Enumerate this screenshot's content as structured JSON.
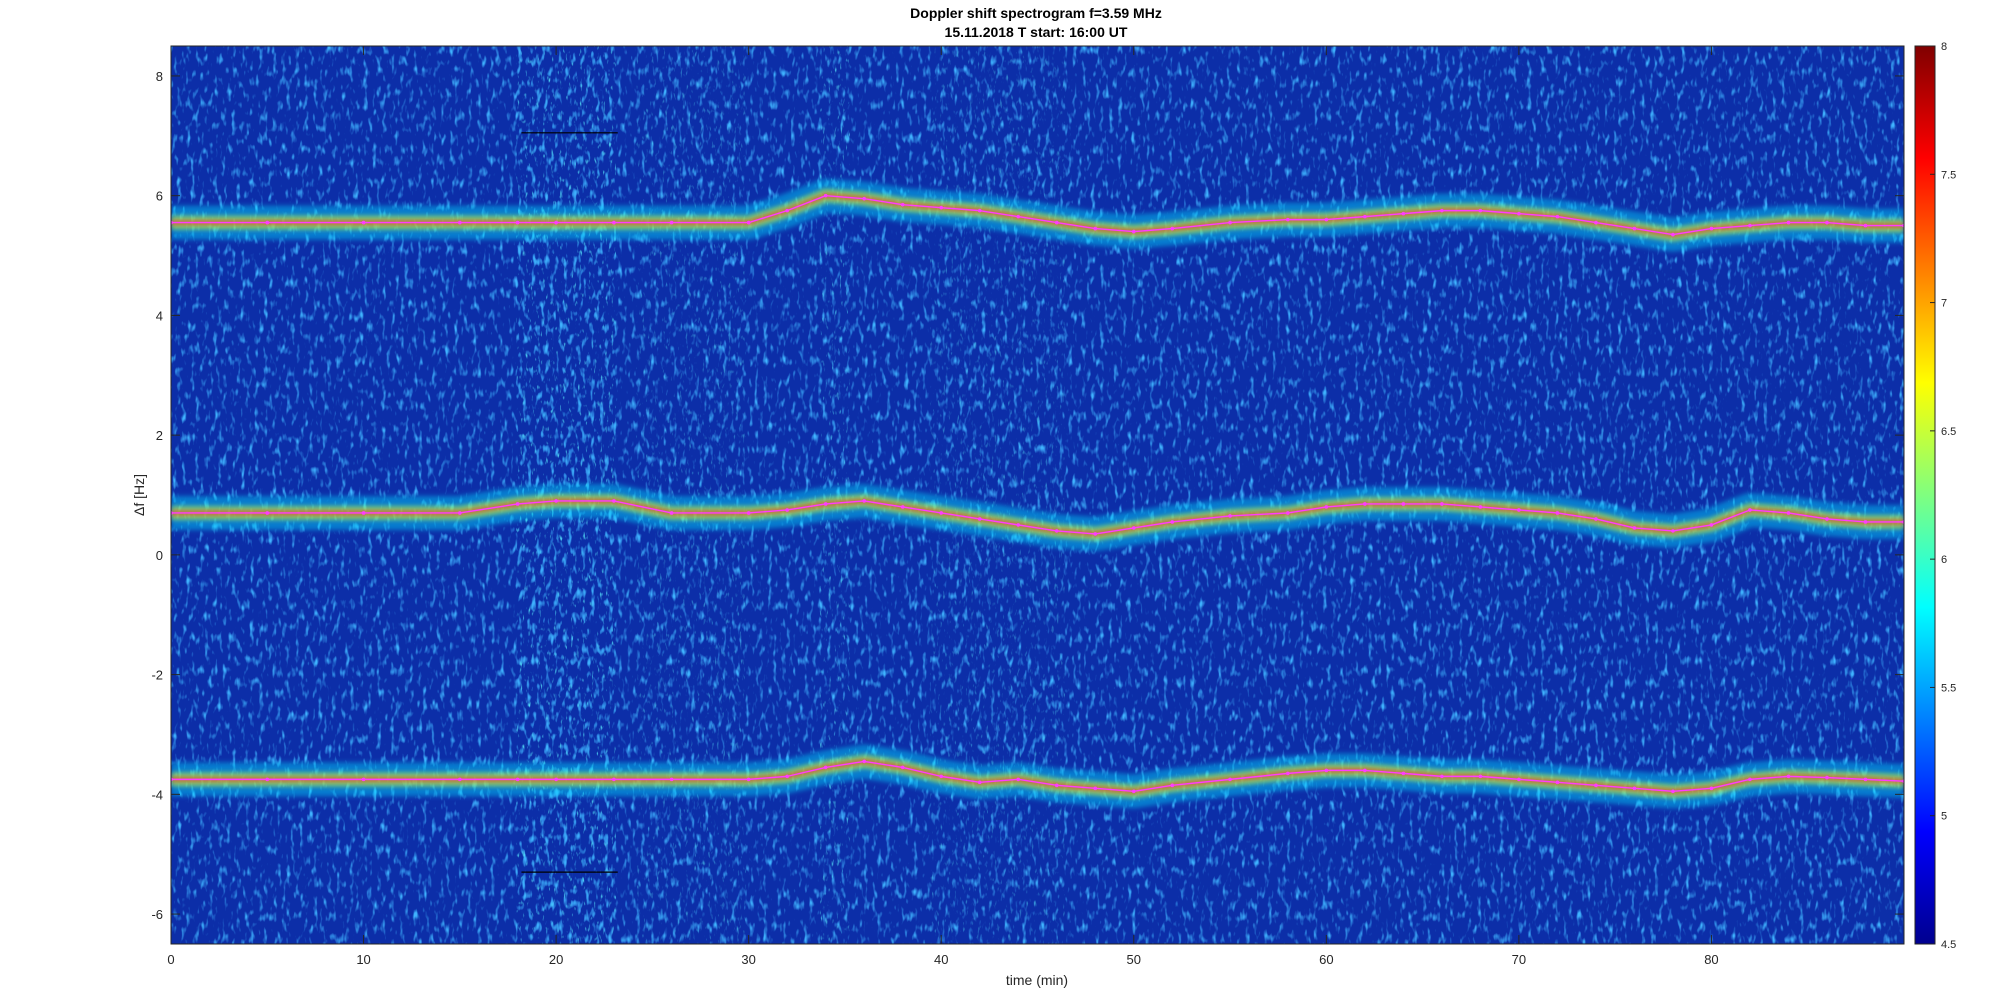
{
  "chart_data": {
    "type": "heatmap",
    "title": "Doppler shift spectrogram f=3.59 MHz",
    "subtitle": "15.11.2018   T start: 16:00 UT",
    "xlabel": "time (min)",
    "ylabel": "Δf [Hz]",
    "xlim": [
      0,
      90
    ],
    "ylim": [
      -6.5,
      8.5
    ],
    "xticks": [
      0,
      10,
      20,
      30,
      40,
      50,
      60,
      70,
      80
    ],
    "xtick_labels": [
      "0",
      "10",
      "20",
      "30",
      "40",
      "50",
      "60",
      "70",
      "80"
    ],
    "yticks": [
      8,
      6,
      4,
      2,
      0,
      -2,
      -4,
      -6
    ],
    "ytick_labels": [
      "8",
      "6",
      "4",
      "2",
      "0",
      "-2",
      "-4",
      "-6"
    ],
    "colormap": "jet",
    "clim": [
      4.5,
      8
    ],
    "colorbar_ticks": [
      8,
      7.5,
      7,
      6.5,
      6,
      5.5,
      5,
      4.5
    ],
    "colorbar_tick_labels": [
      "8",
      "7.5",
      "7",
      "6.5",
      "6",
      "5.5",
      "5",
      "4.5"
    ],
    "grid": false,
    "series": [
      {
        "x": [
          0,
          5,
          10,
          15,
          18,
          20,
          23,
          26,
          30,
          32,
          34,
          36,
          38,
          40,
          42,
          44,
          46,
          48,
          50,
          52,
          55,
          58,
          60,
          62,
          64,
          66,
          68,
          70,
          72,
          74,
          76,
          78,
          80,
          82,
          84,
          86,
          88,
          90
        ],
        "y": [
          5.55,
          5.55,
          5.55,
          5.55,
          5.55,
          5.55,
          5.55,
          5.55,
          5.55,
          5.75,
          6.0,
          5.95,
          5.85,
          5.8,
          5.75,
          5.65,
          5.55,
          5.45,
          5.4,
          5.45,
          5.55,
          5.6,
          5.6,
          5.65,
          5.7,
          5.75,
          5.75,
          5.7,
          5.65,
          5.55,
          5.45,
          5.35,
          5.45,
          5.5,
          5.55,
          5.55,
          5.5,
          5.5
        ]
      },
      {
        "x": [
          0,
          5,
          10,
          15,
          18,
          20,
          23,
          26,
          30,
          32,
          34,
          36,
          38,
          40,
          42,
          44,
          46,
          48,
          50,
          52,
          55,
          58,
          60,
          62,
          64,
          66,
          68,
          70,
          72,
          74,
          76,
          78,
          80,
          82,
          84,
          86,
          88,
          90
        ],
        "y": [
          0.7,
          0.7,
          0.7,
          0.7,
          0.85,
          0.9,
          0.9,
          0.7,
          0.7,
          0.75,
          0.85,
          0.9,
          0.8,
          0.7,
          0.6,
          0.5,
          0.4,
          0.35,
          0.45,
          0.55,
          0.65,
          0.7,
          0.8,
          0.85,
          0.85,
          0.85,
          0.8,
          0.75,
          0.7,
          0.6,
          0.45,
          0.4,
          0.5,
          0.75,
          0.7,
          0.6,
          0.55,
          0.55
        ]
      },
      {
        "x": [
          0,
          5,
          10,
          15,
          18,
          20,
          23,
          26,
          30,
          32,
          34,
          36,
          38,
          40,
          42,
          44,
          46,
          48,
          50,
          52,
          55,
          58,
          60,
          62,
          64,
          66,
          68,
          70,
          72,
          74,
          76,
          78,
          80,
          82,
          84,
          86,
          88,
          90
        ],
        "y": [
          -3.75,
          -3.75,
          -3.75,
          -3.75,
          -3.75,
          -3.75,
          -3.75,
          -3.75,
          -3.75,
          -3.7,
          -3.55,
          -3.45,
          -3.55,
          -3.7,
          -3.8,
          -3.75,
          -3.85,
          -3.9,
          -3.95,
          -3.85,
          -3.75,
          -3.65,
          -3.6,
          -3.6,
          -3.65,
          -3.7,
          -3.7,
          -3.75,
          -3.8,
          -3.85,
          -3.9,
          -3.95,
          -3.9,
          -3.75,
          -3.7,
          -3.72,
          -3.75,
          -3.78
        ]
      }
    ],
    "overlay_segments": [
      {
        "x": [
          18.2,
          23.2
        ],
        "y": [
          7.05,
          7.05
        ]
      },
      {
        "x": [
          18.2,
          23.2
        ],
        "y": [
          -5.3,
          -5.3
        ]
      }
    ],
    "colors": {
      "trace": "#ff3cff",
      "marker": "#000000",
      "background": "#0c2ea8",
      "axis": "#262626"
    }
  }
}
